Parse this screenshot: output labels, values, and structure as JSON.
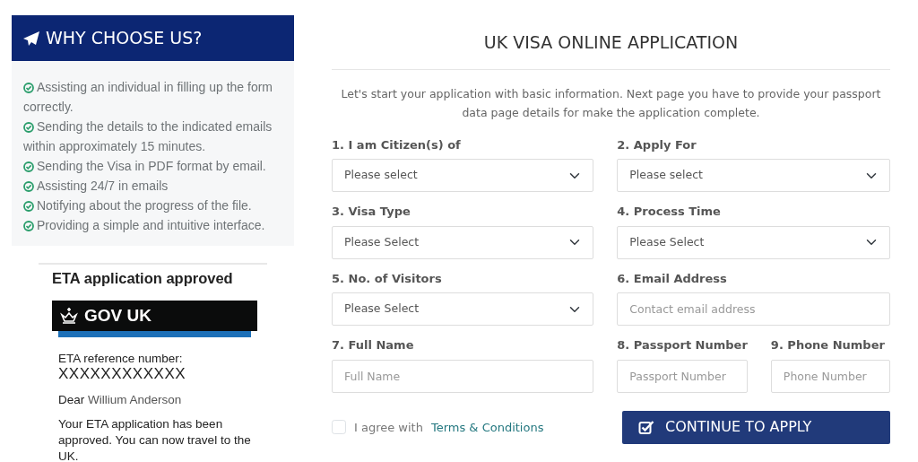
{
  "sidebar": {
    "title": "WHY CHOOSE US?",
    "items": [
      "Assisting an individual in filling up the form correctly.",
      "Sending the details to the indicated emails within approximately 15 minutes.",
      "Sending the Visa in PDF format by email.",
      "Assisting 24/7 in emails",
      "Notifying about the progress of the file.",
      "Providing a simple and intuitive interface."
    ]
  },
  "sample_document": {
    "heading": "ETA application approved",
    "banner": "GOV UK",
    "reference_label": "ETA reference number:",
    "reference_number": "XXXXXXXXXXXX",
    "greeting": "Dear",
    "name": "Willium Anderson",
    "message": "Your ETA application has been approved. You can now travel to the UK."
  },
  "form": {
    "title": "UK VISA ONLINE APPLICATION",
    "intro": "Let's start your application with basic information. Next page you have to provide your passport data page details for make the application complete.",
    "fields": [
      {
        "label": "1. I am Citizen(s) of",
        "kind": "select",
        "value": "Please select"
      },
      {
        "label": "2. Apply For",
        "kind": "select",
        "value": "Please select"
      },
      {
        "label": "3. Visa Type",
        "kind": "select",
        "value": "Please Select"
      },
      {
        "label": "4. Process Time",
        "kind": "select",
        "value": "Please Select"
      },
      {
        "label": "5. No. of Visitors",
        "kind": "select",
        "value": "Please Select"
      },
      {
        "label": "6. Email Address",
        "kind": "input",
        "placeholder": "Contact email address"
      },
      {
        "label": "7. Full Name",
        "kind": "input",
        "placeholder": "Full Name"
      },
      {
        "label": "8. Passport Number",
        "kind": "input",
        "placeholder": "Passport Number"
      },
      {
        "label": "9. Phone Number",
        "kind": "input",
        "placeholder": "Phone Number"
      }
    ],
    "agree": {
      "checked": false,
      "text": "I agree with",
      "link": "Terms & Conditions"
    },
    "submit": "CONTINUE TO APPLY"
  }
}
